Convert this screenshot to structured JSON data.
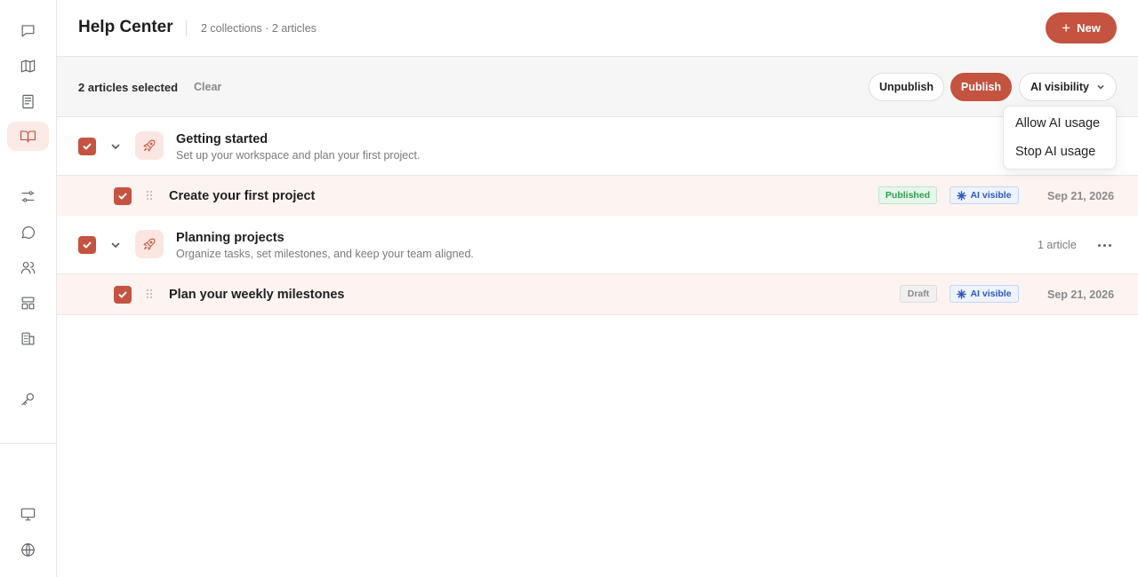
{
  "sidebar": {
    "icons": [
      "chat-bubble-icon",
      "map-icon",
      "newspaper-icon",
      "book-open-icon",
      "sliders-icon",
      "message-circle-icon",
      "users-icon",
      "layout-icon",
      "building-icon",
      "key-icon",
      "monitor-icon",
      "globe-icon"
    ],
    "active": "book-open-icon"
  },
  "header": {
    "title": "Help Center",
    "meta": "2 collections · 2 articles",
    "new_label": "New"
  },
  "selection": {
    "count_label": "2 articles selected",
    "clear_label": "Clear",
    "unpublish_label": "Unpublish",
    "publish_label": "Publish",
    "ai_visibility_label": "AI visibility"
  },
  "ai_menu": {
    "items": [
      "Allow AI usage",
      "Stop AI usage"
    ]
  },
  "collections": [
    {
      "title": "Getting started",
      "description": "Set up your workspace and plan your first project.",
      "count": "",
      "articles": [
        {
          "title": "Create your first project",
          "status": "Published",
          "ai": "AI visible",
          "date": "Sep 21, 2026"
        }
      ]
    },
    {
      "title": "Planning projects",
      "description": "Organize tasks, set milestones, and keep your team aligned.",
      "count": "1 article",
      "articles": [
        {
          "title": "Plan your weekly milestones",
          "status": "Draft",
          "ai": "AI visible",
          "date": "Sep 21, 2026"
        }
      ]
    }
  ],
  "colors": {
    "accent": "#c4533f",
    "accent_soft": "#fbeae6",
    "row_selected": "#fdf3f1",
    "published_text": "#2e9e4f",
    "ai_text": "#2d58c7"
  }
}
